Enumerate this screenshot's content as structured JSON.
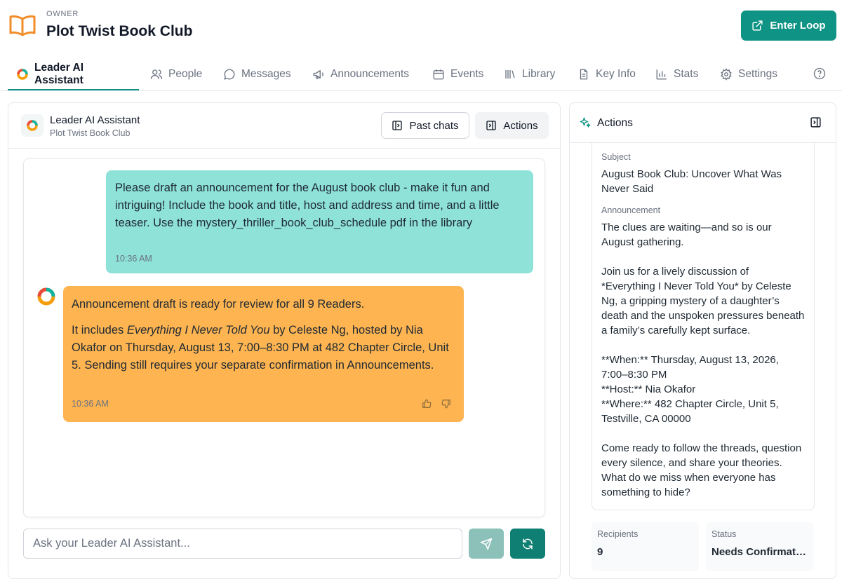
{
  "header": {
    "role": "OWNER",
    "club_name": "Plot Twist Book Club",
    "enter_button": "Enter Loop",
    "accent_color": "#0f9384"
  },
  "tabs": [
    {
      "label": "Leader AI Assistant",
      "icon": "ai-ring-icon",
      "active": true
    },
    {
      "label": "People",
      "icon": "people-icon"
    },
    {
      "label": "Messages",
      "icon": "chat-bubble-icon"
    },
    {
      "label": "Announcements",
      "icon": "megaphone-icon"
    },
    {
      "label": "Events",
      "icon": "calendar-icon"
    },
    {
      "label": "Library",
      "icon": "library-icon"
    },
    {
      "label": "Key Info",
      "icon": "document-icon"
    },
    {
      "label": "Stats",
      "icon": "bar-chart-icon"
    },
    {
      "label": "Settings",
      "icon": "gear-icon"
    }
  ],
  "chat": {
    "title": "Leader AI Assistant",
    "subtitle": "Plot Twist Book Club",
    "past_chats_label": "Past chats",
    "actions_label": "Actions",
    "user_message": {
      "text": "Please draft an announcement for the August book club - make it fun and intriguing! Include the book and title, host and address and time, and a little teaser. Use the mystery_thriller_book_club_schedule pdf in the library",
      "time": "10:36 AM"
    },
    "ai_message": {
      "line1": "Announcement draft is ready for review for all 9 Readers.",
      "line2_pre": "It includes ",
      "line2_book": "Everything I Never Told You",
      "line2_post": " by Celeste Ng, hosted by Nia Okafor on Thursday, August 13, 7:00–8:30 PM at 482 Chapter Circle, Unit 5. Sending still requires your separate confirmation in Announcements.",
      "time": "10:36 AM"
    },
    "input_placeholder": "Ask your Leader AI Assistant..."
  },
  "actions_panel": {
    "title": "Actions",
    "subject_label": "Subject",
    "subject": "August Book Club: Uncover What Was Never Said",
    "announcement_label": "Announcement",
    "announcement": "The clues are waiting—and so is our August gathering.\n\nJoin us for a lively discussion of *Everything I Never Told You* by Celeste Ng, a gripping mystery of a daughter’s death and the unspoken pressures beneath a family’s carefully kept surface.\n\n**When:** Thursday, August 13, 2026, 7:00–8:30 PM\n**Host:** Nia Okafor\n**Where:** 482 Chapter Circle, Unit 5, Testville, CA 00000\n\nCome ready to follow the threads, question every silence, and share your theories. What do we miss when everyone has something to hide?",
    "recipients_label": "Recipients",
    "recipients": "9",
    "status_label": "Status",
    "status": "Needs Confirmation"
  }
}
